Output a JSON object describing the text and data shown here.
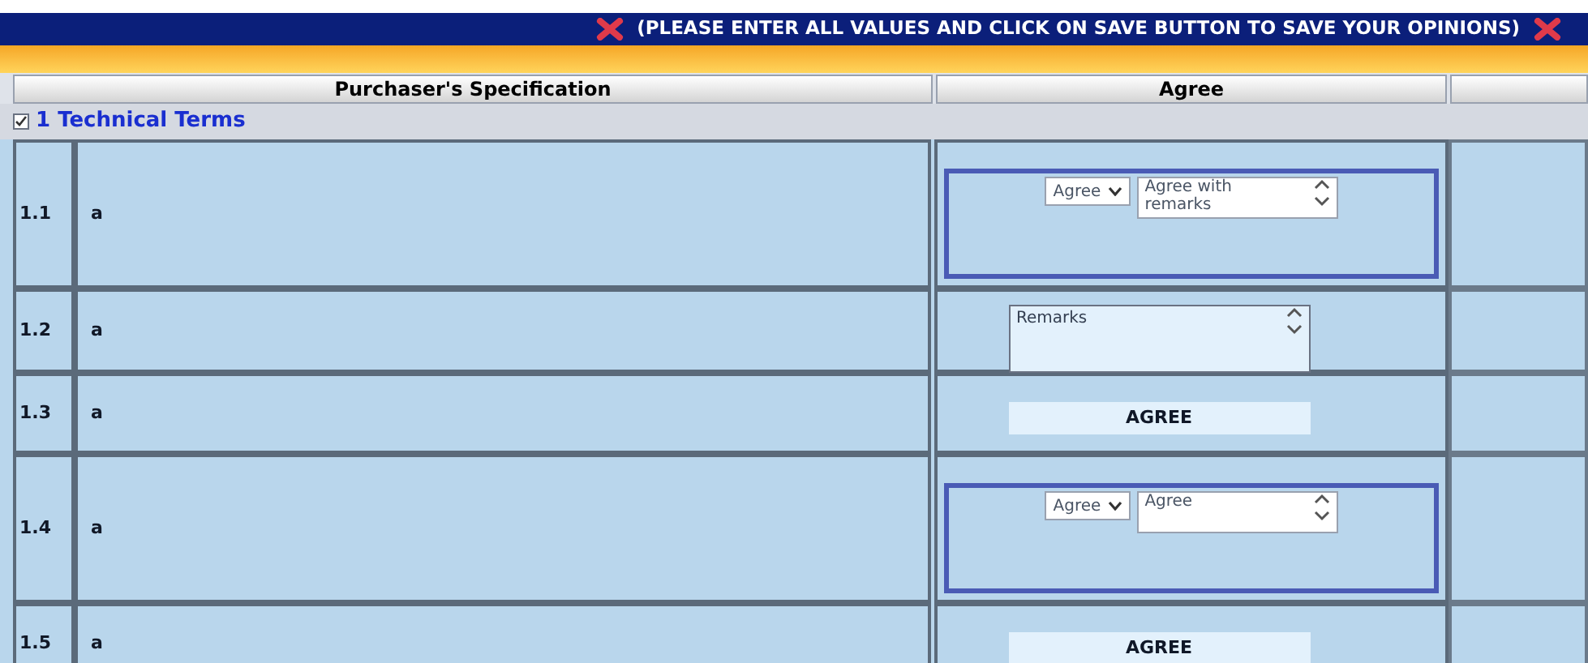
{
  "banner": {
    "text": "(PLEASE ENTER ALL VALUES AND CLICK ON SAVE BUTTON TO SAVE YOUR OPINIONS)"
  },
  "columns": [
    "Purchaser's Specification",
    "Agree"
  ],
  "section": {
    "title": "1 Technical Terms",
    "checked": true
  },
  "rows": [
    {
      "number": "1.1",
      "spec": "a",
      "kind": "select",
      "choice": "Agree",
      "comment": "Agree with remarks"
    },
    {
      "number": "1.2",
      "spec": "a",
      "kind": "remarks",
      "placeholder": "Remarks"
    },
    {
      "number": "1.3",
      "spec": "a",
      "kind": "status",
      "status": "AGREE"
    },
    {
      "number": "1.4",
      "spec": "a",
      "kind": "select",
      "choice": "Agree",
      "comment": "Agree"
    },
    {
      "number": "1.5",
      "spec": "a",
      "kind": "status",
      "status": "AGREE"
    }
  ]
}
